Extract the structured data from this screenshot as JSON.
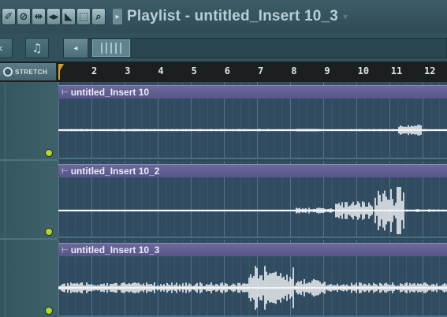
{
  "window": {
    "title": "Playlist - untitled_Insert 10_3",
    "title_dropdown": "▾"
  },
  "toolbar": {
    "icons": [
      "pencil-icon",
      "mute-icon",
      "slip-icon",
      "playback-icon",
      "slice-icon",
      "select-icon",
      "zoom-icon"
    ],
    "glyphs": [
      "✐",
      "⊘",
      "⇹",
      "◂▸",
      "◣",
      "⬚",
      "⌕"
    ],
    "play_arrow": "▸"
  },
  "row2": {
    "left_tab_a": "‹",
    "left_tab_b": "♫",
    "scroll_left": "◂"
  },
  "stretch": {
    "label": "STRETCH"
  },
  "ruler": {
    "ticks": [
      "2",
      "3",
      "4",
      "5",
      "6",
      "7",
      "8",
      "9",
      "10",
      "11",
      "12"
    ]
  },
  "tracks": [
    {
      "clip_name": "untitled_Insert 10",
      "clip_arrow": "⊢"
    },
    {
      "clip_name": "untitled_Insert 10_2",
      "clip_arrow": "⊢"
    },
    {
      "clip_name": "untitled_Insert 10_3",
      "clip_arrow": "⊢"
    }
  ],
  "colors": {
    "background": "#2c4a55",
    "clip_header": "#6b6a9a",
    "track_bg": "#314c60",
    "waveform": "#f2f4f6",
    "ruler_marker": "#d99a2a",
    "track_dot": "#b4d629",
    "title_text": "#b8cfd6"
  }
}
